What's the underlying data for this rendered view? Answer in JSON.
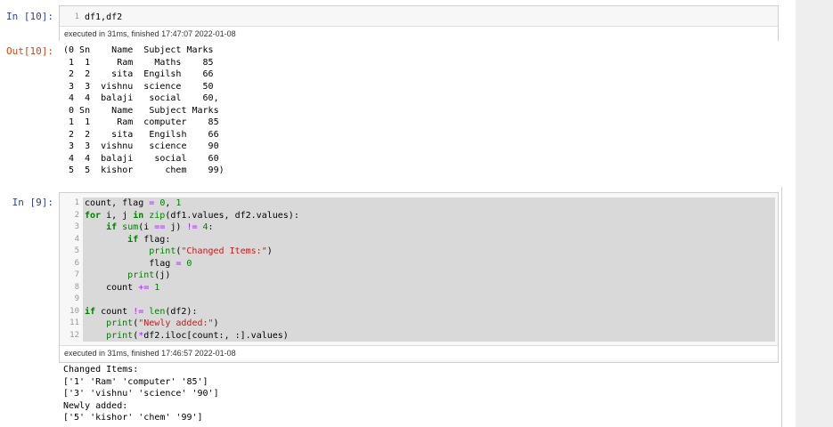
{
  "cell1": {
    "in_prompt": "In [10]:",
    "line_numbers": [
      "1"
    ],
    "code": "df1,df2",
    "status": "executed in 31ms, finished 17:47:07 2022-01-08",
    "out_prompt": "Out[10]:",
    "output_lines": [
      "(0 Sn    Name  Subject Marks",
      " 1  1     Ram    Maths    85",
      " 2  2    sita  Engilsh    66",
      " 3  3  vishnu  science    50",
      " 4  4  balaji   social    60,",
      " 0 Sn    Name   Subject Marks",
      " 1  1     Ram  computer    85",
      " 2  2    sita   Engilsh    66",
      " 3  3  vishnu   science    90",
      " 4  4  balaji    social    60",
      " 5  5  kishor      chem    99)"
    ]
  },
  "cell2": {
    "in_prompt": "In [9]:",
    "line_numbers": [
      "1",
      "2",
      "3",
      "4",
      "5",
      "6",
      "7",
      "8",
      "9",
      "10",
      "11",
      "12"
    ],
    "status": "executed in 31ms, finished 17:46:57 2022-01-08",
    "output_lines": [
      "Changed Items:",
      "['1' 'Ram' 'computer' '85']",
      "['3' 'vishnu' 'science' '90']",
      "Newly added:",
      "['5' 'kishor' 'chem' '99']"
    ]
  },
  "code_lines": [
    [
      {
        "t": "count, flag ",
        "c": ""
      },
      {
        "t": "=",
        "c": "op"
      },
      {
        "t": " ",
        "c": ""
      },
      {
        "t": "0",
        "c": "num"
      },
      {
        "t": ", ",
        "c": ""
      },
      {
        "t": "1",
        "c": "num"
      }
    ],
    [
      {
        "t": "for",
        "c": "kw"
      },
      {
        "t": " i, j ",
        "c": ""
      },
      {
        "t": "in",
        "c": "kw"
      },
      {
        "t": " ",
        "c": ""
      },
      {
        "t": "zip",
        "c": "bi"
      },
      {
        "t": "(df1.values, df2.values):",
        "c": ""
      }
    ],
    [
      {
        "t": "    ",
        "c": ""
      },
      {
        "t": "if",
        "c": "kw"
      },
      {
        "t": " ",
        "c": ""
      },
      {
        "t": "sum",
        "c": "bi"
      },
      {
        "t": "(i ",
        "c": ""
      },
      {
        "t": "==",
        "c": "op"
      },
      {
        "t": " j) ",
        "c": ""
      },
      {
        "t": "!=",
        "c": "op"
      },
      {
        "t": " ",
        "c": ""
      },
      {
        "t": "4",
        "c": "num"
      },
      {
        "t": ":",
        "c": ""
      }
    ],
    [
      {
        "t": "        ",
        "c": ""
      },
      {
        "t": "if",
        "c": "kw"
      },
      {
        "t": " flag:",
        "c": ""
      }
    ],
    [
      {
        "t": "            ",
        "c": ""
      },
      {
        "t": "print",
        "c": "bi"
      },
      {
        "t": "(",
        "c": ""
      },
      {
        "t": "\"Changed Items:\"",
        "c": "str"
      },
      {
        "t": ")",
        "c": ""
      }
    ],
    [
      {
        "t": "            flag ",
        "c": ""
      },
      {
        "t": "=",
        "c": "op"
      },
      {
        "t": " ",
        "c": ""
      },
      {
        "t": "0",
        "c": "num"
      }
    ],
    [
      {
        "t": "        ",
        "c": ""
      },
      {
        "t": "print",
        "c": "bi"
      },
      {
        "t": "(j)",
        "c": ""
      }
    ],
    [
      {
        "t": "    count ",
        "c": ""
      },
      {
        "t": "+=",
        "c": "op"
      },
      {
        "t": " ",
        "c": ""
      },
      {
        "t": "1",
        "c": "num"
      }
    ],
    [
      {
        "t": "",
        "c": ""
      }
    ],
    [
      {
        "t": "if",
        "c": "kw"
      },
      {
        "t": " count ",
        "c": ""
      },
      {
        "t": "!=",
        "c": "op"
      },
      {
        "t": " ",
        "c": ""
      },
      {
        "t": "len",
        "c": "bi"
      },
      {
        "t": "(df2):",
        "c": ""
      }
    ],
    [
      {
        "t": "    ",
        "c": ""
      },
      {
        "t": "print",
        "c": "bi"
      },
      {
        "t": "(",
        "c": ""
      },
      {
        "t": "\"Newly added:\"",
        "c": "str"
      },
      {
        "t": ")",
        "c": ""
      }
    ],
    [
      {
        "t": "    ",
        "c": ""
      },
      {
        "t": "print",
        "c": "bi"
      },
      {
        "t": "(",
        "c": ""
      },
      {
        "t": "*",
        "c": "op"
      },
      {
        "t": "df2.iloc[count:, :].values)",
        "c": ""
      }
    ]
  ]
}
